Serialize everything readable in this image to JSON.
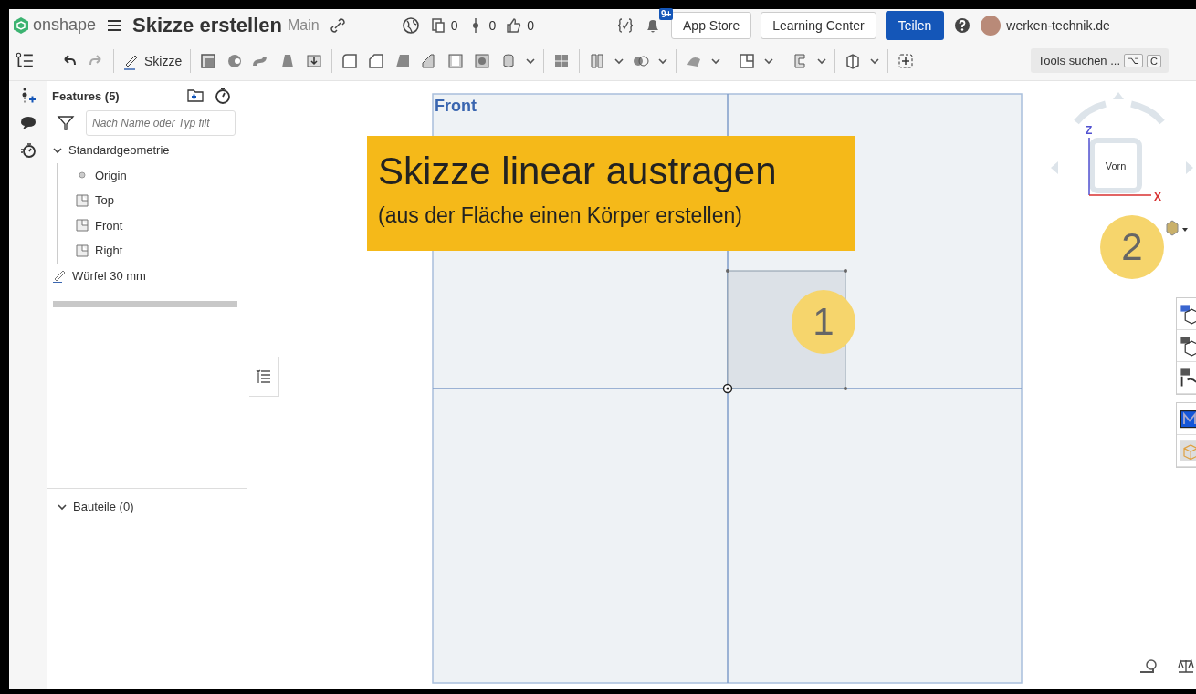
{
  "header": {
    "logo": "onshape",
    "title": "Skizze erstellen",
    "branch": "Main",
    "counts": [
      "0",
      "0",
      "0"
    ],
    "notification_badge": "9+",
    "buttons": [
      "App Store",
      "Learning Center"
    ],
    "share": "Teilen",
    "user": "werken-technik.de"
  },
  "toolbar": {
    "sketch": "Skizze",
    "search": "Tools suchen ...",
    "shortcut_keys": [
      "⌥",
      "C"
    ]
  },
  "features": {
    "title": "Features (5)",
    "filter_placeholder": "Nach Name oder Typ filt",
    "tree": [
      {
        "label": "Standardgeometrie",
        "kind": "folder",
        "expanded": true,
        "children": [
          {
            "label": "Origin",
            "kind": "point"
          },
          {
            "label": "Top",
            "kind": "plane"
          },
          {
            "label": "Front",
            "kind": "plane"
          },
          {
            "label": "Right",
            "kind": "plane"
          }
        ]
      },
      {
        "label": "Würfel 30 mm",
        "kind": "sketch"
      }
    ],
    "parts": {
      "label": "Bauteile (0)",
      "expanded": true
    }
  },
  "viewport": {
    "plane_label": "Front",
    "view_cube": "Vorn",
    "axes": [
      "Z",
      "X"
    ]
  },
  "overlay": {
    "title": "Skizze linear austragen",
    "subtitle": "(aus der Fläche einen Körper erstellen)",
    "markers": [
      "1",
      "2"
    ]
  }
}
